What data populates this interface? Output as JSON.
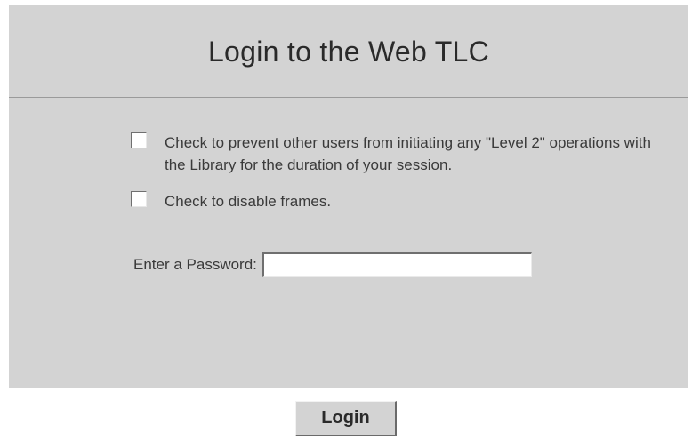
{
  "header": {
    "title": "Login to the Web TLC"
  },
  "options": {
    "lock_library_label": "Check to prevent other users from initiating any \"Level 2\" operations with the Library for the duration of your session.",
    "lock_library_checked": false,
    "disable_frames_label": "Check to disable frames.",
    "disable_frames_checked": false
  },
  "password": {
    "label": "Enter a Password:",
    "value": ""
  },
  "actions": {
    "login_label": "Login"
  },
  "colors": {
    "panel_background": "#d3d3d3",
    "page_background": "#ffffff"
  }
}
